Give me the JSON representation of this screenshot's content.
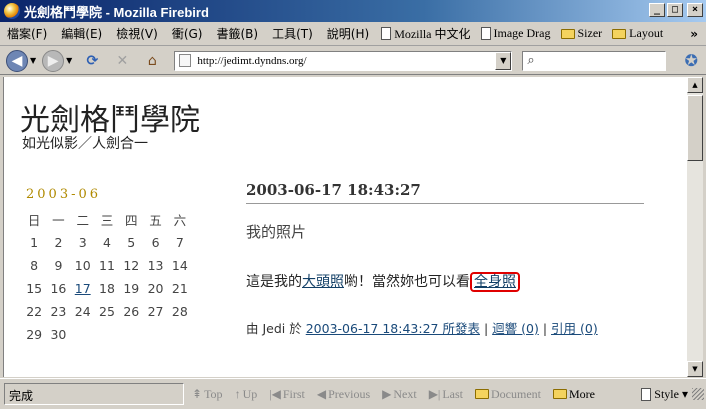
{
  "window": {
    "title": "光劍格鬥學院 - Mozilla Firebird",
    "controls": {
      "minimize": "_",
      "maximize": "□",
      "close": "×"
    }
  },
  "menubar": {
    "items": [
      "檔案(F)",
      "編輯(E)",
      "檢視(V)",
      "衝(G)",
      "書籤(B)",
      "工具(T)",
      "說明(H)"
    ],
    "bookmarks": [
      {
        "label": "Mozilla 中文化",
        "icon": "page-icon"
      },
      {
        "label": "Image Drag",
        "icon": "page-icon"
      },
      {
        "label": "Sizer",
        "icon": "folder-icon"
      },
      {
        "label": "Layout",
        "icon": "folder-icon"
      }
    ],
    "overflow": "»"
  },
  "navbar": {
    "url": "http://jedimt.dyndns.org/",
    "search_value": ""
  },
  "page": {
    "site_title": "光劍格鬥學院",
    "tagline": "如光似影／人劍合一",
    "calendar": {
      "title": "2003-06",
      "weekdays": [
        "日",
        "一",
        "二",
        "三",
        "四",
        "五",
        "六"
      ],
      "weeks": [
        [
          "1",
          "2",
          "3",
          "4",
          "5",
          "6",
          "7"
        ],
        [
          "8",
          "9",
          "10",
          "11",
          "12",
          "13",
          "14"
        ],
        [
          "15",
          "16",
          "17",
          "18",
          "19",
          "20",
          "21"
        ],
        [
          "22",
          "23",
          "24",
          "25",
          "26",
          "27",
          "28"
        ],
        [
          "29",
          "30",
          "",
          "",
          "",
          "",
          ""
        ]
      ],
      "linked_day": "17"
    },
    "post": {
      "date": "2003-06-17 18:43:27",
      "title": "我的照片",
      "body_prefix": "這是我的",
      "link1": "大頭照",
      "body_middle": "喲！當然妳也可以看",
      "link2": "全身照",
      "meta_by": "由 Jedi 於",
      "meta_posted": "2003-06-17 18:43:27 所發表",
      "sep": "|",
      "replies": "迴響 (0)",
      "trackbacks": "引用 (0)"
    }
  },
  "statusbar": {
    "status": "完成",
    "nav": [
      {
        "label": "Top",
        "glyph": "⇞",
        "active": false
      },
      {
        "label": "Up",
        "glyph": "↑",
        "active": false
      },
      {
        "label": "First",
        "glyph": "|◀",
        "active": false
      },
      {
        "label": "Previous",
        "glyph": "◀",
        "active": false
      },
      {
        "label": "Next",
        "glyph": "▶",
        "active": false
      },
      {
        "label": "Last",
        "glyph": "▶|",
        "active": false
      },
      {
        "label": "Document",
        "glyph": "",
        "active": false
      },
      {
        "label": "More",
        "glyph": "",
        "active": true
      }
    ],
    "style_label": "Style"
  }
}
